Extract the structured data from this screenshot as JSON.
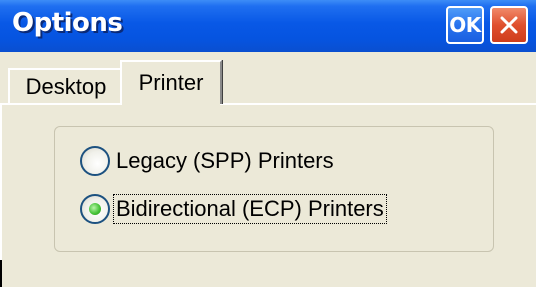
{
  "window": {
    "title": "Options",
    "ok_label": "OK",
    "close_icon": "close-x"
  },
  "tabs": [
    {
      "label": "Desktop",
      "selected": false
    },
    {
      "label": "Printer",
      "selected": true
    }
  ],
  "printer_options": [
    {
      "label": "Legacy (SPP) Printers",
      "selected": false
    },
    {
      "label": "Bidirectional (ECP) Printers",
      "selected": true,
      "focused": true
    }
  ],
  "colors": {
    "titlebar": "#0858e6",
    "close_button": "#e0502e",
    "radio_selected": "#48c43a",
    "background": "#ece9d8"
  }
}
